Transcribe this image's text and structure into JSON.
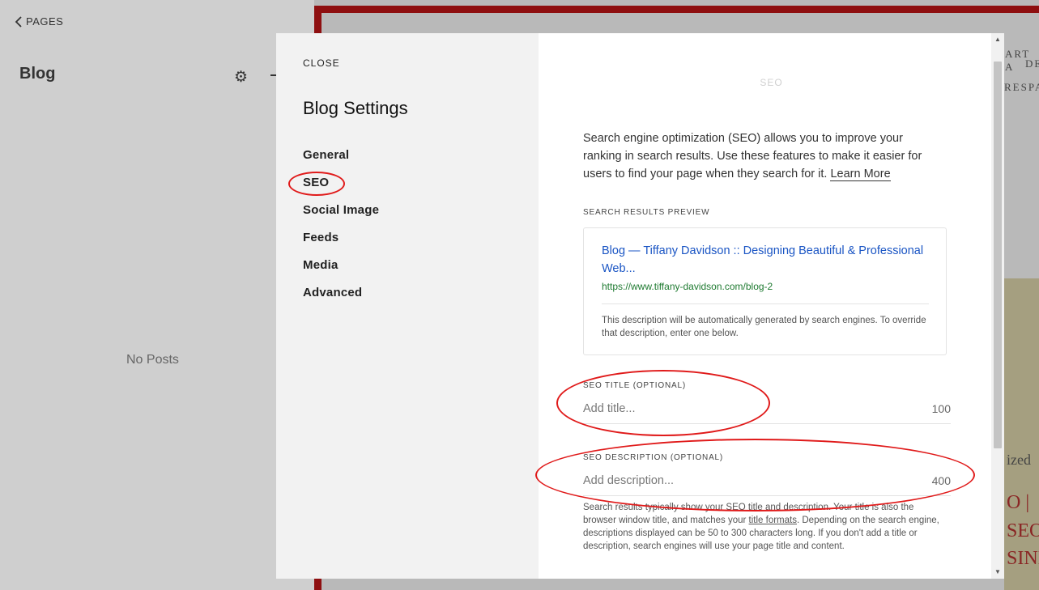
{
  "editor": {
    "back_label": "PAGES",
    "panel_title": "Blog",
    "empty_text": "No Posts"
  },
  "site_preview": {
    "frag1": "ART A",
    "frag2": "DE",
    "frag3": "RESPA",
    "frag4": "ized",
    "frag5": "O |",
    "frag6": "SEO",
    "frag7": "SINI"
  },
  "modal": {
    "close_label": "CLOSE",
    "title": "Blog Settings",
    "nav": [
      "General",
      "SEO",
      "Social Image",
      "Feeds",
      "Media",
      "Advanced"
    ],
    "active_section": "SEO"
  },
  "seo": {
    "heading": "SEO",
    "intro": "Search engine optimization (SEO) allows you to improve your ranking in search results. Use these features to make it easier for users to find your page when they search for it.",
    "learn_more": "Learn More",
    "preview_label": "SEARCH RESULTS PREVIEW",
    "preview_title": "Blog — Tiffany Davidson :: Designing Beautiful & Professional Web...",
    "preview_url": "https://www.tiffany-davidson.com/blog-2",
    "preview_description": "This description will be automatically generated by search engines. To override that description, enter one below.",
    "title_label": "SEO TITLE (OPTIONAL)",
    "title_placeholder": "Add title...",
    "title_count": "100",
    "desc_label": "SEO DESCRIPTION (OPTIONAL)",
    "desc_placeholder": "Add description...",
    "desc_count": "400",
    "help_part1": "Search results typically show your SEO title and description. Your title is also the browser window title, and matches your",
    "help_link": "title formats",
    "help_part2": ". Depending on the search engine, descriptions displayed can be 50 to 300 characters long. If you don't add a title or description, search engines will use your page title and content."
  },
  "colors": {
    "annotation": "#e01a1a",
    "link_blue": "#1a55c4",
    "url_green": "#1e7a30",
    "site_border": "#8e0f10"
  }
}
